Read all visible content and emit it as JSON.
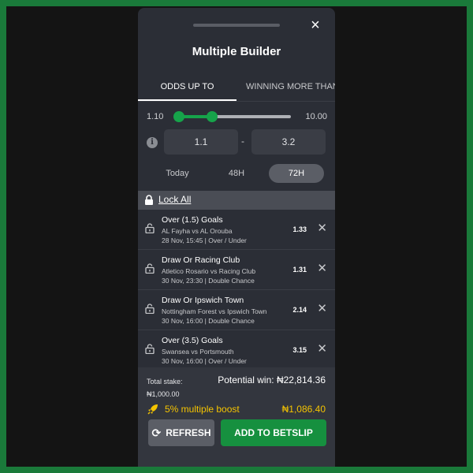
{
  "sheet": {
    "title": "Multiple Builder",
    "close_icon": "×"
  },
  "tabs": [
    {
      "label": "ODDS UP TO",
      "active": true
    },
    {
      "label": "WINNING MORE THAN",
      "active": false
    }
  ],
  "slider": {
    "min_label": "1.10",
    "max_label": "10.00",
    "min": 1.1,
    "max": 10.0,
    "low": 1.1,
    "high": 3.2
  },
  "range": {
    "low_value": "1.1",
    "separator": "-",
    "high_value": "3.2",
    "info_icon": "i"
  },
  "time_filters": [
    {
      "label": "Today",
      "active": false
    },
    {
      "label": "48H",
      "active": false
    },
    {
      "label": "72H",
      "active": true
    }
  ],
  "lock_all": {
    "label": "Lock All",
    "icon": "lock-icon"
  },
  "bets": [
    {
      "selection": "Over (1.5) Goals",
      "match": "AL Fayha vs AL Orouba",
      "details": "28 Nov, 15:45 | Over / Under",
      "odds": "1.33"
    },
    {
      "selection": "Draw Or Racing Club",
      "match": "Atletico Rosario vs Racing Club",
      "details": "30 Nov, 23:30 | Double Chance",
      "odds": "1.31"
    },
    {
      "selection": "Draw Or Ipswich Town",
      "match": "Nottingham Forest vs Ipswich Town",
      "details": "30 Nov, 16:00 | Double Chance",
      "odds": "2.14"
    },
    {
      "selection": "Over (3.5) Goals",
      "match": "Swansea vs Portsmouth",
      "details": "30 Nov, 16:00 | Over / Under",
      "odds": "3.15"
    }
  ],
  "footer": {
    "stake_label": "Total stake:",
    "stake_value": "₦1,000.00",
    "potential_win": "Potential win: ₦22,814.36",
    "boost_label": "5% multiple boost",
    "boost_value": "₦1,086.40",
    "refresh_label": "REFRESH",
    "add_label": "ADD TO BETSLIP"
  },
  "colors": {
    "accent": "#16a34a",
    "boost": "#f5c400",
    "sheet_bg": "#2b2e36"
  }
}
